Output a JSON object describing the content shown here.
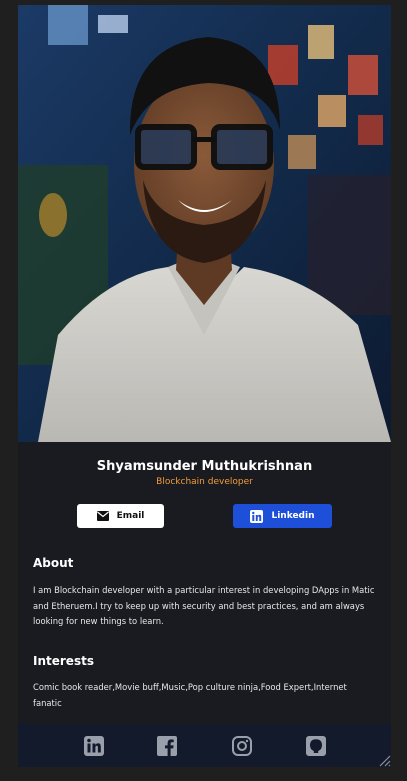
{
  "profile": {
    "name": "Shyamsunder Muthukrishnan",
    "role": "Blockchain developer",
    "photo": "profile-photo"
  },
  "actions": {
    "email_label": "Email",
    "email_icon": "envelope-icon",
    "linkedin_label": "Linkedin",
    "linkedin_icon": "linkedin-icon"
  },
  "about": {
    "title": "About",
    "text": "I am Blockchain developer with a particular interest in developing DApps in Matic and Etheruem.I try to keep up with security and best practices, and am always looking for new things to learn."
  },
  "interests": {
    "title": "Interests",
    "text": "Comic book reader,Movie buff,Music,Pop culture ninja,Food Expert,Internet fanatic"
  },
  "footer": {
    "icons": [
      "linkedin-icon",
      "facebook-icon",
      "instagram-icon",
      "github-icon"
    ]
  },
  "colors": {
    "background": "#1f1f20",
    "card": "#1a1b20",
    "accent_orange": "#f39b3a",
    "linkedin_blue": "#1e4fd8",
    "footer": "#121a2b"
  }
}
